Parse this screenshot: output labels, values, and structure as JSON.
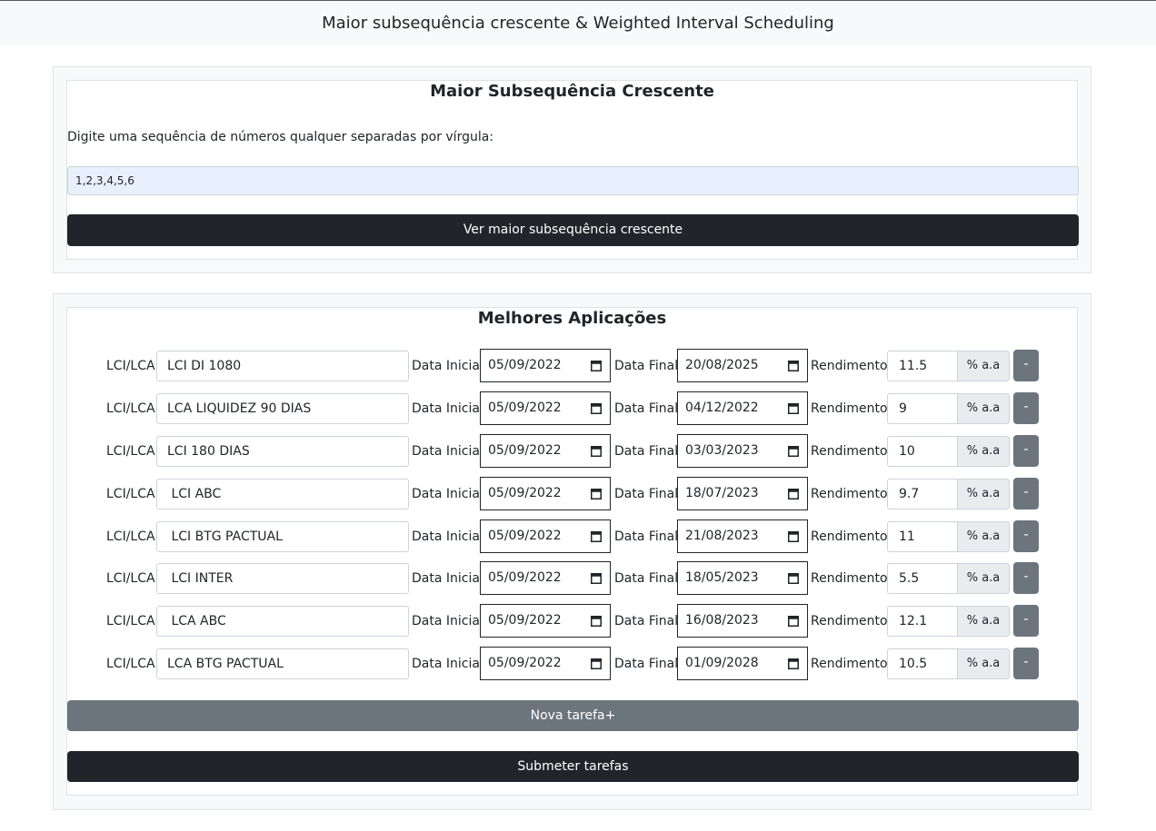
{
  "header": {
    "title": "Maior subsequência crescente & Weighted Interval Scheduling"
  },
  "lis": {
    "title": "Maior Subsequência Crescente",
    "prompt": "Digite uma sequência de números qualquer separadas por vírgula:",
    "input_value": "1,2,3,4,5,6",
    "button_label": "Ver maior subsequência crescente"
  },
  "apps": {
    "title": "Melhores Aplicações",
    "labels": {
      "name": "LCI/LCA:",
      "start": "Data Inicial:",
      "end": "Data Final:",
      "yield": "Rendimento:",
      "suffix": "% a.a",
      "remove": "-"
    },
    "rows": [
      {
        "name": "LCI DI 1080",
        "start": "05/09/2022",
        "end": "20/08/2025",
        "yield": "11.5"
      },
      {
        "name": "LCA LIQUIDEZ 90 DIAS",
        "start": "05/09/2022",
        "end": "04/12/2022",
        "yield": "9"
      },
      {
        "name": "LCI 180 DIAS",
        "start": "05/09/2022",
        "end": "03/03/2023",
        "yield": "10"
      },
      {
        "name": " LCI ABC",
        "start": "05/09/2022",
        "end": "18/07/2023",
        "yield": "9.7"
      },
      {
        "name": " LCI BTG PACTUAL",
        "start": "05/09/2022",
        "end": "21/08/2023",
        "yield": "11"
      },
      {
        "name": " LCI INTER",
        "start": "05/09/2022",
        "end": "18/05/2023",
        "yield": "5.5"
      },
      {
        "name": " LCA ABC",
        "start": "05/09/2022",
        "end": "16/08/2023",
        "yield": "12.1"
      },
      {
        "name": "LCA BTG PACTUAL",
        "start": "05/09/2022",
        "end": "01/09/2028",
        "yield": "10.5"
      }
    ],
    "add_button": "Nova tarefa+",
    "submit_button": "Submeter tarefas"
  }
}
